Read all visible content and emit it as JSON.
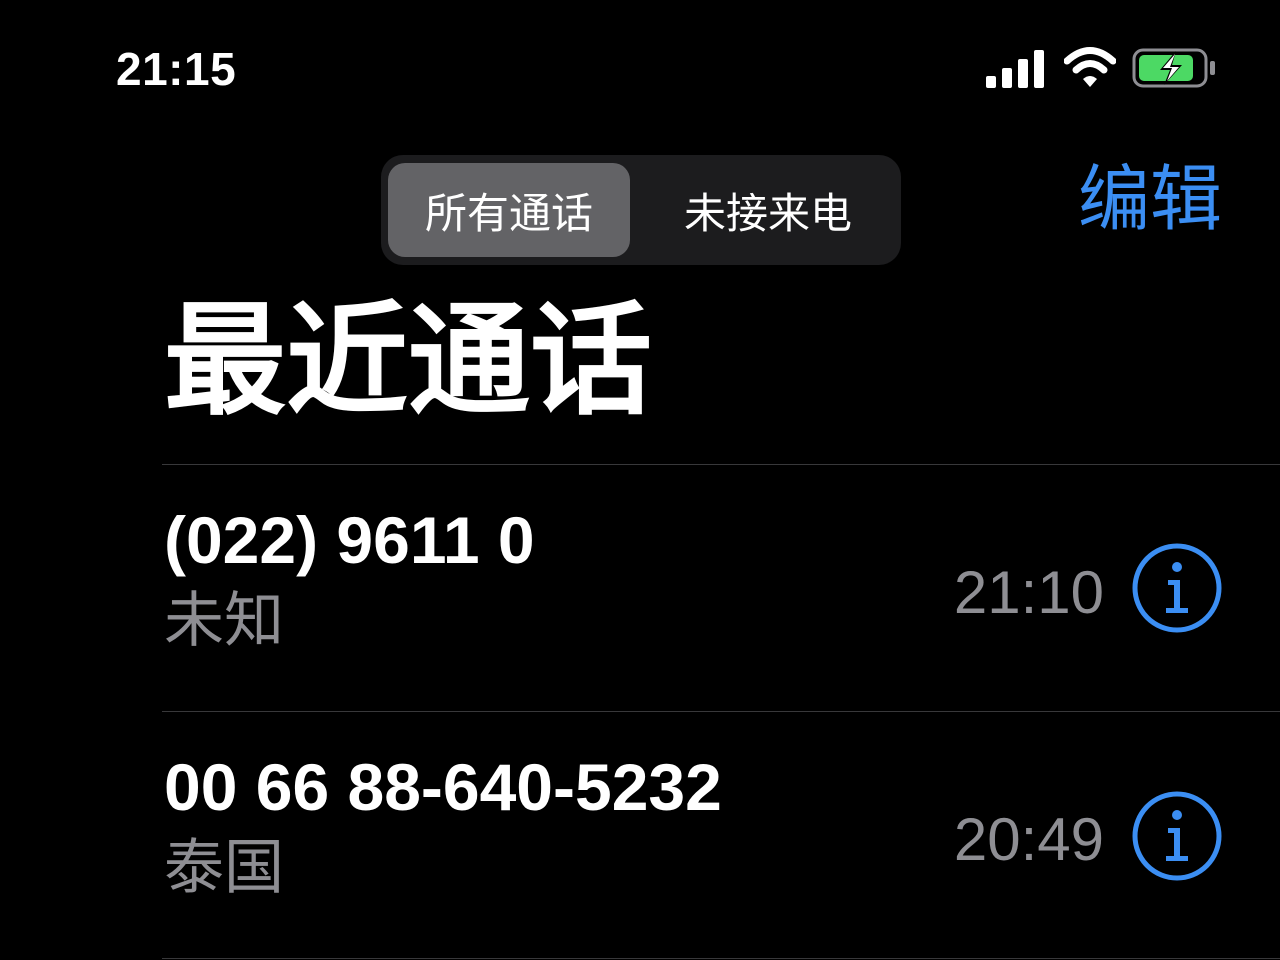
{
  "status_bar": {
    "time": "21:15"
  },
  "segments": {
    "all_label": "所有通话",
    "missed_label": "未接来电",
    "selected": "all"
  },
  "edit_label": "编辑",
  "title": "最近通话",
  "calls": [
    {
      "number": "(022) 9611 0",
      "label": "未知",
      "time": "21:10"
    },
    {
      "number": "00 66 88-640-5232",
      "label": "泰国",
      "time": "20:49"
    }
  ],
  "colors": {
    "accent": "#3b8ef3",
    "battery_charging": "#4cd964",
    "secondary_text": "#8e8e93"
  }
}
